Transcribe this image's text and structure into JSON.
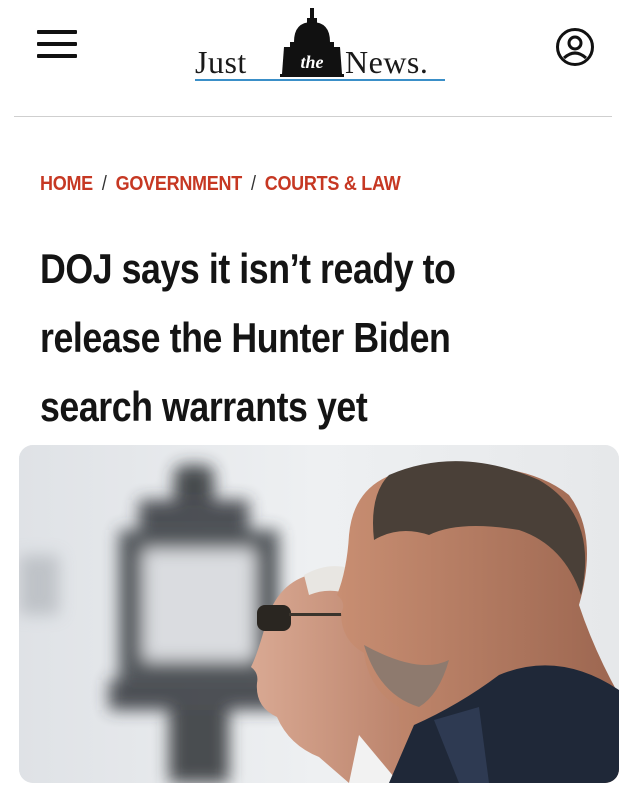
{
  "header": {
    "logo_left": "Just",
    "logo_the": "the",
    "logo_right": "News."
  },
  "icons": {
    "menu": "hamburger-menu-icon",
    "account": "user-account-icon",
    "logo": "capitol-dome-logo"
  },
  "breadcrumb": {
    "items": [
      "HOME",
      "GOVERNMENT",
      "COURTS & LAW"
    ],
    "separator": "/"
  },
  "article": {
    "headline_lines": [
      "DOJ says it isn’t ready to",
      "release the Hunter Biden",
      "search warrants yet"
    ]
  },
  "colors": {
    "accent": "#c63823",
    "text": "#141414",
    "logo_underline": "#3a8fc8"
  }
}
